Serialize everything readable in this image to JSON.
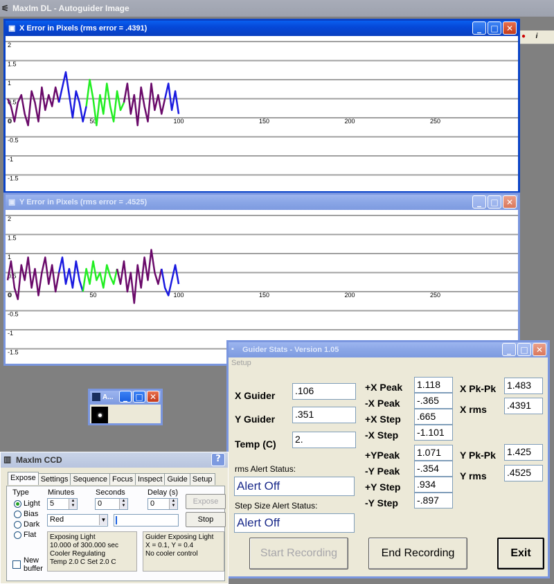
{
  "app": {
    "title": "MaxIm DL - Autoguider Image"
  },
  "toolbar_strip": {
    "icons": [
      "record-icon",
      "info-icon"
    ]
  },
  "x_window": {
    "title": "X Error in Pixels    (rms error = .4391)",
    "y_ticks": [
      "2",
      "1.5",
      "1",
      "0.5",
      "0",
      "-0.5",
      "-1",
      "-1.5"
    ],
    "x_ticks": [
      "0",
      "50",
      "100",
      "150",
      "200",
      "250"
    ]
  },
  "y_window": {
    "title": "Y Error in Pixels    (rms error = .4525)",
    "y_ticks": [
      "2",
      "1.5",
      "1",
      "0.5",
      "0",
      "-0.5",
      "-1",
      "-1.5"
    ],
    "x_ticks": [
      "0",
      "50",
      "100",
      "150",
      "200",
      "250"
    ]
  },
  "chart_data": [
    {
      "type": "line",
      "title": "X Error in Pixels    (rms error = .4391)",
      "ylim": [
        -2,
        2
      ],
      "xlim": [
        0,
        300
      ],
      "x_ticks": [
        0,
        50,
        100,
        150,
        200,
        250
      ],
      "y_ticks": [
        2,
        1.5,
        1,
        0.5,
        0,
        -0.5,
        -1,
        -1.5
      ],
      "series": [
        {
          "color": "#6a0a6a",
          "x": [
            0,
            2,
            4,
            6,
            8,
            10,
            12,
            14,
            16,
            18,
            20,
            22,
            24,
            26,
            28,
            30
          ],
          "values": [
            0.5,
            0.3,
            -0.1,
            0.4,
            0.6,
            0.1,
            -0.2,
            0.7,
            0.4,
            -0.1,
            0.8,
            0.2,
            0.6,
            0.3,
            0.8,
            0.4
          ]
        },
        {
          "color": "#1a1ae0",
          "x": [
            30,
            32,
            34,
            36,
            38,
            40,
            42,
            44,
            46
          ],
          "values": [
            0.4,
            0.8,
            1.2,
            0.6,
            0.0,
            0.7,
            0.4,
            -0.1,
            0.3
          ]
        },
        {
          "color": "#22ee22",
          "x": [
            46,
            48,
            50,
            52,
            54,
            56,
            58,
            60,
            62,
            64,
            66,
            68
          ],
          "values": [
            0.3,
            1.0,
            0.5,
            -0.2,
            0.6,
            0.1,
            0.9,
            0.3,
            -0.1,
            0.7,
            0.2,
            0.4
          ]
        },
        {
          "color": "#6a0a6a",
          "x": [
            68,
            70,
            72,
            74,
            76,
            78,
            80,
            82,
            84,
            86,
            88,
            90,
            92
          ],
          "values": [
            0.4,
            0.9,
            0.1,
            0.6,
            -0.2,
            0.8,
            0.3,
            -0.1,
            0.9,
            0.2,
            0.6,
            0.1,
            0.5
          ]
        },
        {
          "color": "#1a1ae0",
          "x": [
            92,
            94,
            96,
            98,
            100
          ],
          "values": [
            0.5,
            0.9,
            0.2,
            0.7,
            0.1
          ]
        }
      ]
    },
    {
      "type": "line",
      "title": "Y Error in Pixels    (rms error = .4525)",
      "ylim": [
        -2,
        2
      ],
      "xlim": [
        0,
        300
      ],
      "x_ticks": [
        0,
        50,
        100,
        150,
        200,
        250
      ],
      "y_ticks": [
        2,
        1.5,
        1,
        0.5,
        0,
        -0.5,
        -1,
        -1.5
      ],
      "series": [
        {
          "color": "#6a0a6a",
          "x": [
            0,
            2,
            4,
            6,
            8,
            10,
            12,
            14,
            16,
            18,
            20,
            22,
            24,
            26,
            28,
            30
          ],
          "values": [
            0.3,
            0.8,
            0.1,
            -0.2,
            0.7,
            0.3,
            0.9,
            0.1,
            0.6,
            -0.1,
            0.5,
            0.9,
            0.2,
            0.7,
            0.0,
            0.5
          ]
        },
        {
          "color": "#1a1ae0",
          "x": [
            30,
            32,
            34,
            36,
            38,
            40,
            42,
            44
          ],
          "values": [
            0.5,
            0.9,
            0.2,
            0.6,
            0.1,
            0.8,
            0.3,
            0.0
          ]
        },
        {
          "color": "#22ee22",
          "x": [
            44,
            46,
            48,
            50,
            52,
            54,
            56,
            58,
            60,
            62,
            64
          ],
          "values": [
            0.0,
            0.6,
            0.2,
            0.8,
            0.3,
            0.5,
            0.1,
            0.7,
            0.4,
            0.2,
            0.6
          ]
        },
        {
          "color": "#6a0a6a",
          "x": [
            64,
            66,
            68,
            70,
            72,
            74,
            76,
            78,
            80,
            82,
            84,
            86,
            88,
            90
          ],
          "values": [
            0.6,
            0.2,
            0.8,
            0.0,
            0.5,
            -0.3,
            0.7,
            0.1,
            0.9,
            0.3,
            1.1,
            0.5,
            0.2,
            0.6
          ]
        },
        {
          "color": "#1a1ae0",
          "x": [
            90,
            92,
            94,
            96,
            98,
            100
          ],
          "values": [
            0.6,
            0.1,
            -0.1,
            0.3,
            0.7,
            0.2
          ]
        }
      ]
    }
  ],
  "mini_window": {
    "title": "A..."
  },
  "guider_stats": {
    "title": "Guider Stats - Version 1.05",
    "menu": "Setup",
    "x_guider_label": "X Guider",
    "x_guider": ".106",
    "y_guider_label": "Y Guider",
    "y_guider": ".351",
    "temp_label": "Temp (C)",
    "temp": "2.",
    "rms_alert_label": "rms Alert Status:",
    "rms_alert": "Alert Off",
    "step_alert_label": "Step Size Alert Status:",
    "step_alert": "Alert Off",
    "px_peak_label": "+X Peak",
    "px_peak": "1.118",
    "nx_peak_label": "-X Peak",
    "nx_peak": "-.365",
    "px_step_label": "+X Step",
    "px_step": ".665",
    "nx_step_label": "-X Step",
    "nx_step": "-1.101",
    "py_peak_label": "+YPeak",
    "py_peak": "1.071",
    "ny_peak_label": "-Y Peak",
    "ny_peak": "-.354",
    "py_step_label": "+Y Step",
    "py_step": ".934",
    "ny_step_label": "-Y Step",
    "ny_step": "-.897",
    "x_pkpk_label": "X Pk-Pk",
    "x_pkpk": "1.483",
    "x_rms_label": "X rms",
    "x_rms": ".4391",
    "y_pkpk_label": "Y Pk-Pk",
    "y_pkpk": "1.425",
    "y_rms_label": "Y rms",
    "y_rms": ".4525",
    "start_button": "Start Recording",
    "end_button": "End Recording",
    "exit_button": "Exit"
  },
  "ccd": {
    "title": "MaxIm CCD",
    "help": "?",
    "tabs": [
      "Expose",
      "Settings",
      "Sequence",
      "Focus",
      "Inspect",
      "Guide",
      "Setup"
    ],
    "type_label": "Type",
    "minutes_label": "Minutes",
    "seconds_label": "Seconds",
    "delay_label": "Delay (s)",
    "types": [
      "Light",
      "Bias",
      "Dark",
      "Flat"
    ],
    "selected_type": "Light",
    "minutes": "5",
    "seconds": "0",
    "delay": "0",
    "filter": "Red",
    "expose_button": "Expose",
    "stop_button": "Stop",
    "new_buffer_label": "New buffer",
    "status_left": [
      "Exposing Light",
      "10.000 of 300.000 sec",
      "Cooler Regulating",
      "Temp 2.0 C Set 2.0 C"
    ],
    "status_right": [
      "Guider Exposing Light",
      "X = 0.1, Y = 0.4",
      "No cooler control"
    ]
  }
}
